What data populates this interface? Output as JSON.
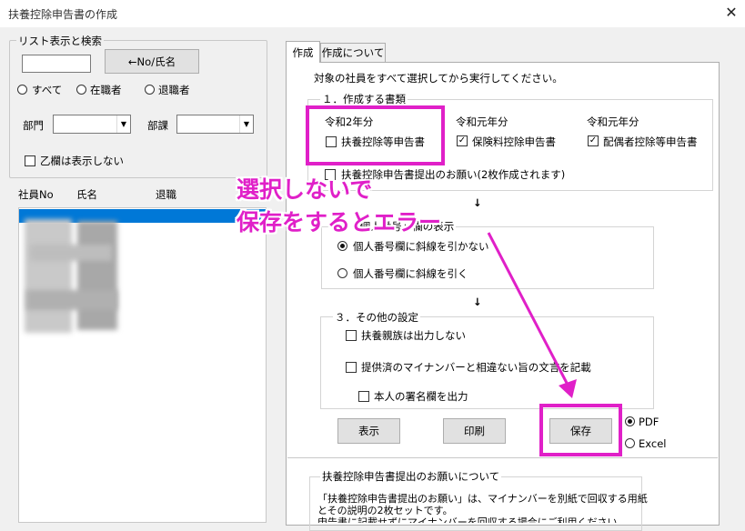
{
  "window": {
    "title": "扶養控除申告書の作成",
    "close_glyph": "✕"
  },
  "left": {
    "search_group": {
      "legend": "リスト表示と検索",
      "search_value": "",
      "search_button": "←No/氏名"
    },
    "filter_radios": [
      {
        "label": "すべて",
        "selected": false
      },
      {
        "label": "在職者",
        "selected": false
      },
      {
        "label": "退職者",
        "selected": false
      }
    ],
    "department_label": "部門",
    "section_label": "部課",
    "hide_otsu_label": "乙欄は表示しない",
    "list_headers": {
      "no": "社員No",
      "name": "氏名",
      "retired": "退職"
    }
  },
  "tabs": [
    {
      "label": "作成",
      "active": true
    },
    {
      "label": "作成について",
      "active": false
    }
  ],
  "main": {
    "instruction": "対象の社員をすべて選択してから実行してください。",
    "section1": {
      "legend": "１．作成する書類",
      "columns": [
        {
          "year": "令和2年分",
          "label": "扶養控除等申告書",
          "checked": false
        },
        {
          "year": "令和元年分",
          "label": "保険料控除申告書",
          "checked": true
        },
        {
          "year": "令和元年分",
          "label": "配偶者控除等申告書",
          "checked": true
        }
      ],
      "request_label": "扶養控除申告書提出のお願い(2枚作成されます)",
      "request_checked": false
    },
    "arrow_glyph": "↓",
    "section2": {
      "legend": "２．「個人番号」欄の表示",
      "options": [
        {
          "label": "個人番号欄に斜線を引かない",
          "selected": true
        },
        {
          "label": "個人番号欄に斜線を引く",
          "selected": false
        }
      ]
    },
    "section3": {
      "legend": "３．その他の設定",
      "options": [
        {
          "label": "扶養親族は出力しない",
          "checked": false
        },
        {
          "label": "提供済のマイナンバーと相違ない旨の文言を記載",
          "checked": false
        },
        {
          "label": "本人の署名欄を出力",
          "checked": false
        }
      ]
    },
    "buttons": {
      "show": "表示",
      "print": "印刷",
      "save": "保存"
    },
    "output_format": [
      {
        "label": "PDF",
        "selected": true
      },
      {
        "label": "Excel",
        "selected": false
      }
    ],
    "request_info": {
      "legend": "扶養控除申告書提出のお願いについて",
      "lines": [
        "「扶養控除申告書提出のお願い」は、マイナンバーを別紙で回収する用紙",
        "とその説明の2枚セットです。",
        "申告書に記載せずにマイナンバーを回収する場合にご利用ください。"
      ]
    }
  },
  "annotation": {
    "line1": "選択しないで",
    "line2": "保存をするとエラー",
    "color": "#e020c8"
  },
  "colors": {
    "selection": "#0078d7",
    "accent_magenta": "#e020c8"
  }
}
